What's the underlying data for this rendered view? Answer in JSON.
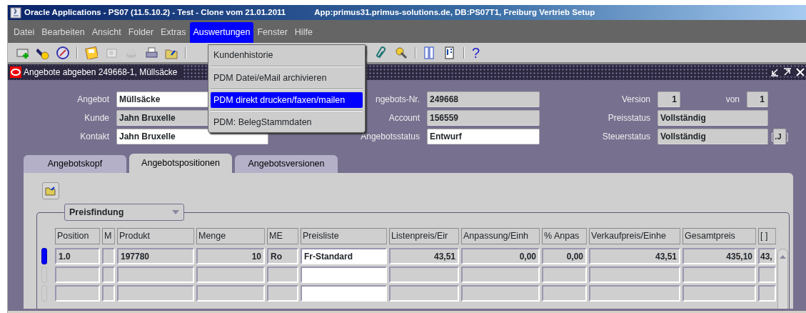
{
  "window": {
    "title": "Oracle Applications - PS07 (11.5.10.2) - Test - Clone vom 21.01.2011",
    "title_info": "App:primus31.primus-solutions.de, DB:PS07T1, Freiburg Vertrieb Setup"
  },
  "menu_bar": [
    {
      "label": "Datei",
      "selected": false
    },
    {
      "label": "Bearbeiten",
      "selected": false
    },
    {
      "label": "Ansicht",
      "selected": false
    },
    {
      "label": "Folder",
      "selected": false
    },
    {
      "label": "Extras",
      "selected": false
    },
    {
      "label": "Auswertungen",
      "selected": true
    },
    {
      "label": "Fenster",
      "selected": false
    },
    {
      "label": "Hilfe",
      "selected": false
    }
  ],
  "open_menu": {
    "items": [
      {
        "label": "Kundenhistorie",
        "selected": false
      },
      {
        "label": "PDM Datei/eMail archivieren",
        "selected": false
      },
      {
        "label": "PDM direkt drucken/faxen/mailen",
        "selected": true
      },
      {
        "label": "PDM: BelegStammdaten",
        "selected": false
      }
    ]
  },
  "toolbar": {
    "help": "?"
  },
  "form_window": {
    "title": "Angebote abgeben 249668-1, Müllsäcke"
  },
  "header_fields": {
    "left": [
      {
        "label": "Angebot",
        "value": "Müllsäcke",
        "editable": true
      },
      {
        "label": "Kunde",
        "value": "Jahn Bruxelle",
        "editable": false
      },
      {
        "label": "Kontakt",
        "value": "Jahn Bruxelle",
        "editable": true
      }
    ],
    "middle": [
      {
        "label": "ngebots-Nr.",
        "value": "249668",
        "editable": false
      },
      {
        "label": "Account",
        "value": "156559",
        "editable": false
      },
      {
        "label": "Angebotsstatus",
        "value": "Entwurf",
        "editable": true
      }
    ],
    "right": [
      {
        "kind": "version",
        "label": "Version",
        "value": "1",
        "of_label": "von",
        "of_value": "1",
        "editable": false
      },
      {
        "kind": "text",
        "label": "Preisstatus",
        "value": "Vollständig",
        "editable": false
      },
      {
        "kind": "flagged",
        "label": "Steuerstatus",
        "value": "Vollständig",
        "editable": false,
        "flag_open": "[",
        "flag": ".J",
        "flag_close": "]"
      }
    ]
  },
  "tabs": [
    {
      "label": "Angebotskopf",
      "selected": false
    },
    {
      "label": "Angebotspositionen",
      "selected": true
    },
    {
      "label": "Angebotsversionen",
      "selected": false
    }
  ],
  "group": {
    "selector": "Preisfindung"
  },
  "table": {
    "columns": [
      {
        "label": "Position",
        "kind": "text"
      },
      {
        "label": "M",
        "kind": "text"
      },
      {
        "label": "Produkt",
        "kind": "text"
      },
      {
        "label": "Menge",
        "kind": "number"
      },
      {
        "label": "ME",
        "kind": "text"
      },
      {
        "label": "Preisliste",
        "kind": "text",
        "editable": true
      },
      {
        "label": "Listenpreis/Eir",
        "kind": "number"
      },
      {
        "label": "Anpassung/Einh",
        "kind": "number"
      },
      {
        "label": "% Anpas",
        "kind": "number"
      },
      {
        "label": "Verkaufpreis/Einhe",
        "kind": "number"
      },
      {
        "label": "Gesamtpreis",
        "kind": "number"
      },
      {
        "label": "[ ]",
        "kind": "text"
      }
    ],
    "rows": [
      {
        "current": true,
        "cells": [
          "1.0",
          null,
          "197780",
          "10",
          "Ro",
          "Fr-Standard",
          "43,51",
          "0,00",
          "0,00",
          "43,51",
          "435,10",
          "43,"
        ]
      },
      {
        "current": false
      },
      {
        "current": false
      }
    ]
  }
}
